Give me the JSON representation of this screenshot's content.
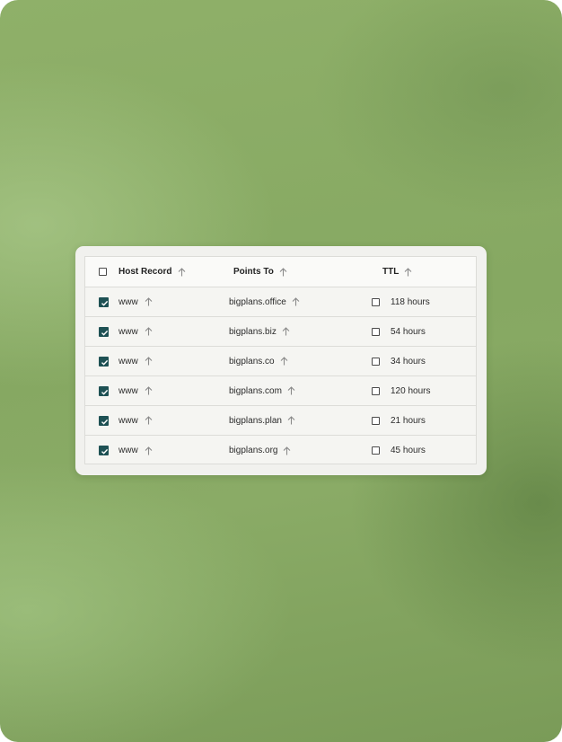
{
  "table": {
    "columns": {
      "host": "Host Record",
      "points": "Points To",
      "ttl": "TTL"
    },
    "header_checkbox_checked": false,
    "rows": [
      {
        "selected": true,
        "host": "www",
        "points_to": "bigplans.office",
        "ttl_checked": false,
        "ttl": "118 hours"
      },
      {
        "selected": true,
        "host": "www",
        "points_to": "bigplans.biz",
        "ttl_checked": false,
        "ttl": "54 hours"
      },
      {
        "selected": true,
        "host": "www",
        "points_to": "bigplans.co",
        "ttl_checked": false,
        "ttl": "34 hours"
      },
      {
        "selected": true,
        "host": "www",
        "points_to": "bigplans.com",
        "ttl_checked": false,
        "ttl": "120 hours"
      },
      {
        "selected": true,
        "host": "www",
        "points_to": "bigplans.plan",
        "ttl_checked": false,
        "ttl": "21 hours"
      },
      {
        "selected": true,
        "host": "www",
        "points_to": "bigplans.org",
        "ttl_checked": false,
        "ttl": "45 hours"
      }
    ]
  },
  "colors": {
    "checkbox_checked": "#1e5154",
    "background_green": "#8aab66"
  },
  "icons": {
    "sort": "arrow-up-icon"
  }
}
